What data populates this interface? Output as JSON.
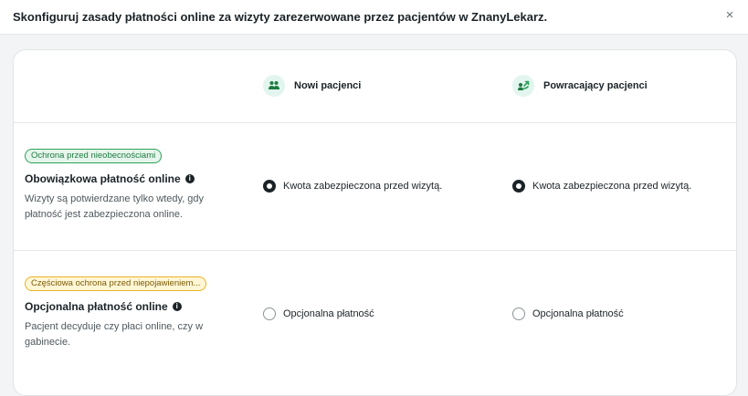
{
  "header": {
    "title": "Skonfiguruj zasady płatności online za wizyty zarezerwowane przez pacjentów w ZnanyLekarz.",
    "close_icon": "close-icon",
    "close_glyph": "×"
  },
  "columns": [
    {
      "label": "Nowi pacjenci",
      "icon": "people-icon"
    },
    {
      "label": "Powracający pacjenci",
      "icon": "returning-patient-icon"
    }
  ],
  "rows": [
    {
      "badge": "Ochrona przed nieobecnościami",
      "badge_color": "#2ea05a",
      "title": "Obowiązkowa płatność online",
      "info_glyph": "i",
      "description": "Wizyty są potwierdzane tylko wtedy, gdy płatność jest zabezpieczona online.",
      "new_patients": {
        "label": "Kwota zabezpieczona przed wizytą.",
        "selected": true
      },
      "returning_patients": {
        "label": "Kwota zabezpieczona przed wizytą.",
        "selected": true
      }
    },
    {
      "badge": "Częściowa ochrona przed niepojawieniem...",
      "badge_color": "#e6b422",
      "title": "Opcjonalna płatność online",
      "info_glyph": "i",
      "description": "Pacjent decyduje czy płaci online, czy w gabinecie.",
      "new_patients": {
        "label": "Opcjonalna płatność",
        "selected": false
      },
      "returning_patients": {
        "label": "Opcjonalna płatność",
        "selected": false
      }
    }
  ],
  "colors": {
    "accent_green": "#2ea05a",
    "icon_bg": "#e2f5ee",
    "text": "#1b2327"
  }
}
